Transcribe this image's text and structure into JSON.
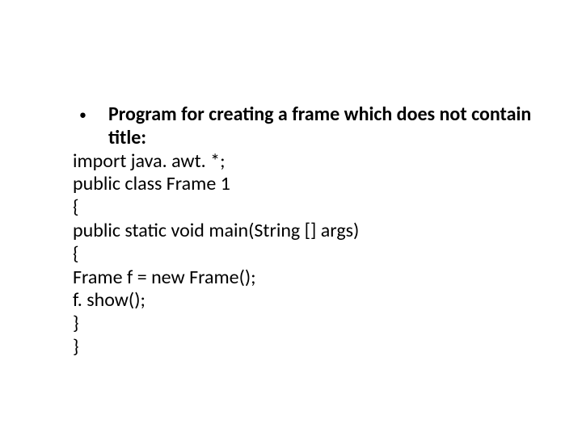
{
  "bullet": {
    "glyph": "•",
    "heading": "Program for creating a frame which does not contain title:"
  },
  "lines": [
    "import java. awt. *;",
    "public class Frame 1",
    "{",
    "public static void main(String [] args)",
    "{",
    "Frame f = new Frame();",
    "f. show();",
    "}",
    "}"
  ]
}
